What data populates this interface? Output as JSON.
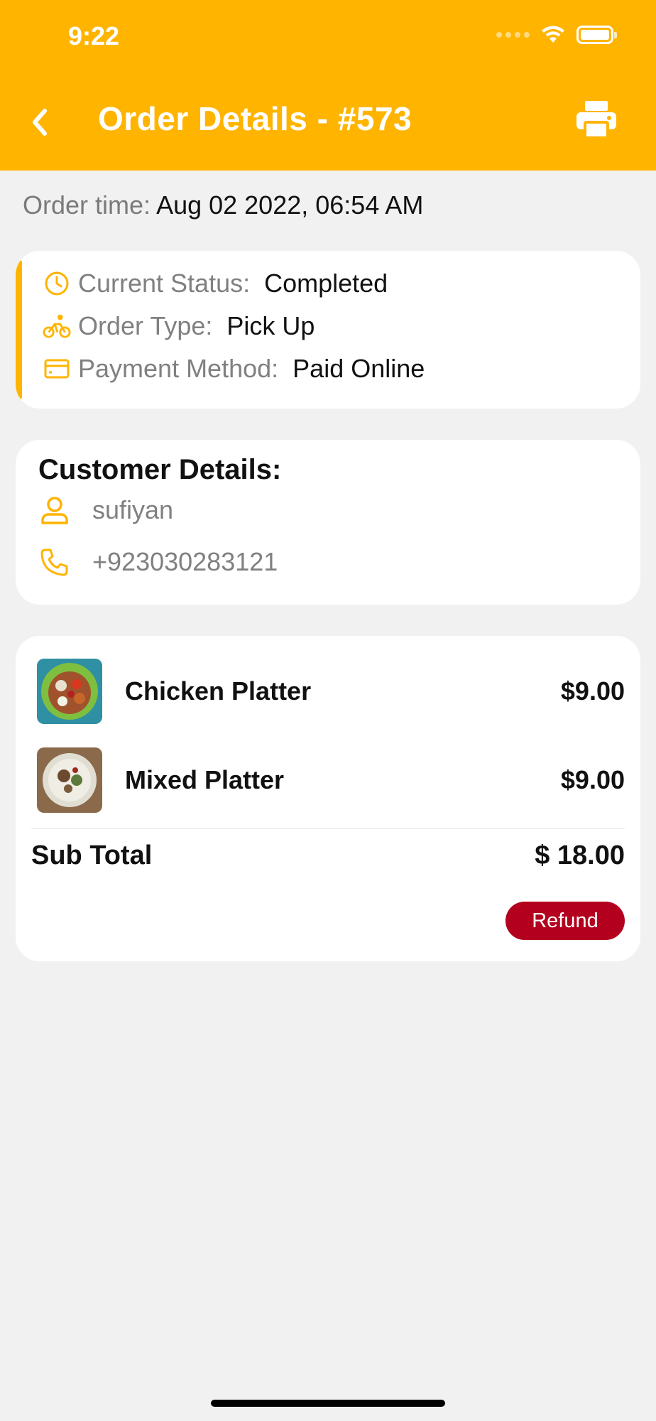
{
  "status_bar": {
    "time": "9:22"
  },
  "header": {
    "title": "Order Details - #573",
    "back_icon": "chevron-left-icon",
    "print_icon": "printer-icon"
  },
  "order_time": {
    "label": "Order time:",
    "value": "Aug 02 2022, 06:54 AM"
  },
  "status": {
    "current_status_label": "Current Status:",
    "current_status_value": "Completed",
    "order_type_label": "Order Type:",
    "order_type_value": "Pick Up",
    "payment_label": "Payment Method:",
    "payment_value": "Paid Online"
  },
  "customer": {
    "title": "Customer Details:",
    "name": "sufiyan",
    "phone": "+923030283121"
  },
  "items": [
    {
      "name": "Chicken Platter",
      "price": "$9.00"
    },
    {
      "name": "Mixed Platter",
      "price": "$9.00"
    }
  ],
  "totals": {
    "label": "Sub Total",
    "value": "$ 18.00"
  },
  "actions": {
    "refund_label": "Refund"
  },
  "colors": {
    "accent": "#ffb400",
    "refund": "#b3001e"
  }
}
